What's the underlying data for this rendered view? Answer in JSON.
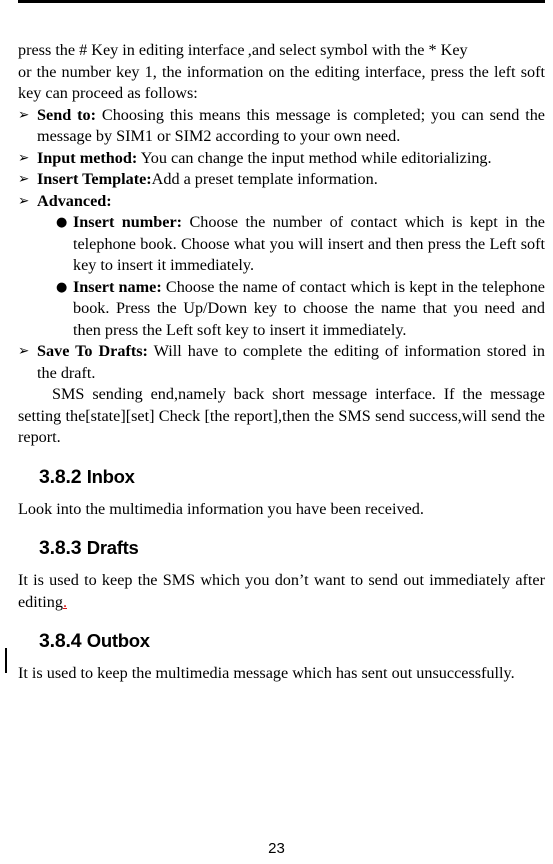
{
  "page": {
    "number": "23",
    "header_rule": true,
    "change_bar_present": true
  },
  "intro": {
    "line1": "press the # Key in editing interface ,and select symbol with the * Key",
    "rest": "or the number key 1, the information on the editing interface, press the left soft key can proceed as follows:"
  },
  "markers": {
    "level1": "➢",
    "level2": "●"
  },
  "options": [
    {
      "lead": "Send to:",
      "body": " Choosing this means this message is completed; you can send the message by SIM1 or SIM2 according to your own need."
    },
    {
      "lead": "Input method:",
      "body": " You can change the input method while editorializing."
    },
    {
      "lead": "Insert Template:",
      "body": "Add a preset template information."
    },
    {
      "lead": "Advanced:",
      "body": ""
    }
  ],
  "advanced_subitems": [
    {
      "lead": "Insert number:",
      "body": " Choose the number of contact which is kept in the telephone book. Choose what you will insert and then press the Left soft key to insert it immediately."
    },
    {
      "lead": "Insert name:",
      "body": " Choose the name of contact which is kept in the telephone book. Press the Up/Down key to choose the name that you need and then press the Left soft key to insert it immediately."
    }
  ],
  "save_to_drafts": {
    "lead": "Save To Drafts:",
    "body": " Will have to complete the editing of information stored in the draft."
  },
  "sms_note": "SMS sending end,namely back short message interface. If the message setting the[state][set] Check [the report],then the SMS send success,will send the report.",
  "sections": [
    {
      "number": "3.8.2",
      "title": "Inbox",
      "body": "Look into the multimedia information you have been received."
    },
    {
      "number": "3.8.3",
      "title": "Drafts",
      "body_before": "It is used to keep the SMS which you don’t want to send out immediately after editing",
      "tracked_insert": ".",
      "body_after": ""
    },
    {
      "number": "3.8.4",
      "title": "Outbox",
      "body": "It is used to keep the multimedia message which has sent out unsuccessfully."
    }
  ]
}
